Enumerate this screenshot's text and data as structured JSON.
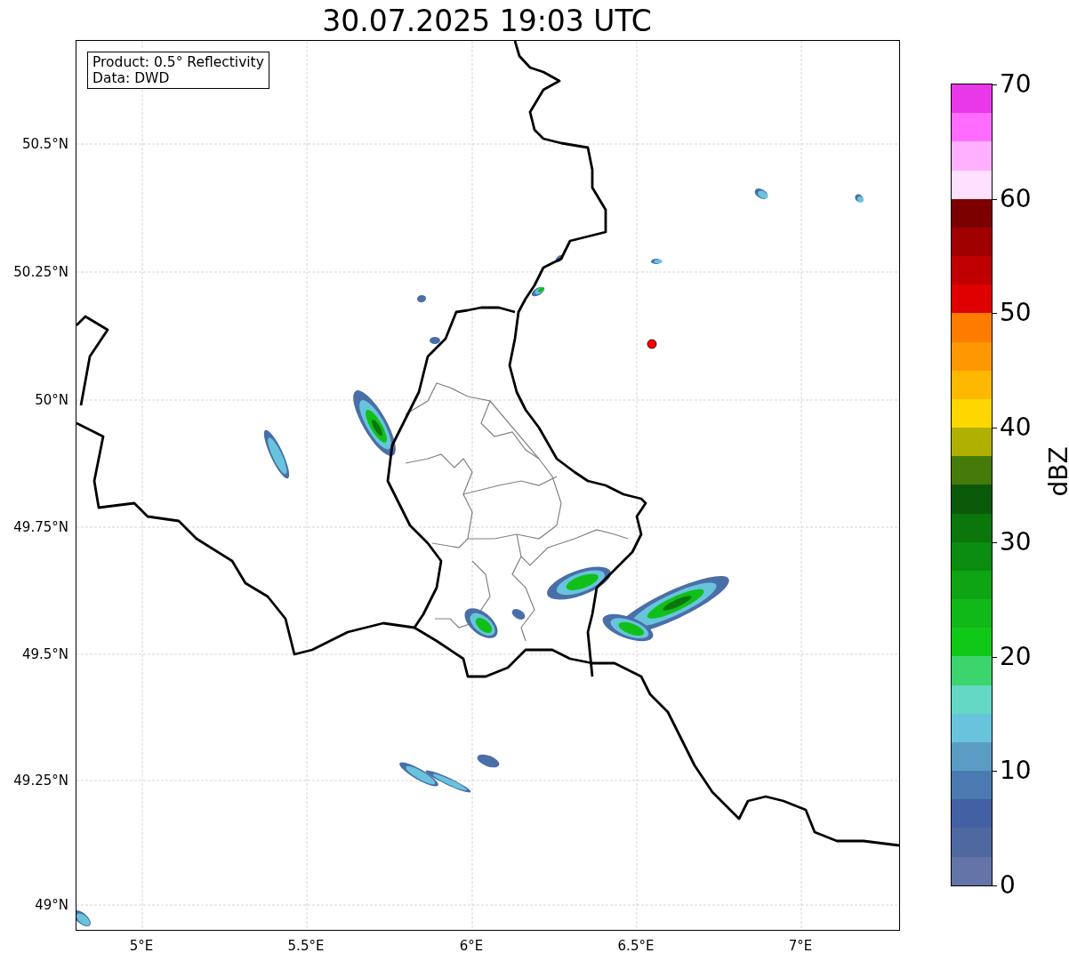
{
  "title": "30.07.2025 19:03 UTC",
  "info_box": {
    "lines": [
      "Product: 0.5° Reflectivity",
      "Data: DWD"
    ]
  },
  "lat_ticks": [
    "50.5°N",
    "50.25°N",
    "50°N",
    "49.75°N",
    "49.5°N",
    "49.25°N",
    "49°N"
  ],
  "lon_ticks": [
    "5°E",
    "5.5°E",
    "6°E",
    "6.5°E",
    "7°E"
  ],
  "colorbar": {
    "label": "dBZ",
    "ticks": [
      "70",
      "60",
      "50",
      "40",
      "30",
      "20",
      "10",
      "0"
    ],
    "bins": [
      {
        "color": "#e838e8"
      },
      {
        "color": "#ff6cff"
      },
      {
        "color": "#ffb0ff"
      },
      {
        "color": "#ffe0ff"
      },
      {
        "color": "#7c0000"
      },
      {
        "color": "#a00000"
      },
      {
        "color": "#c00000"
      },
      {
        "color": "#e00000"
      },
      {
        "color": "#ff7c00"
      },
      {
        "color": "#ff9800"
      },
      {
        "color": "#ffb800"
      },
      {
        "color": "#ffd700"
      },
      {
        "color": "#b0b000"
      },
      {
        "color": "#467a0a"
      },
      {
        "color": "#0a5a0a"
      },
      {
        "color": "#0a760c"
      },
      {
        "color": "#0a8c10"
      },
      {
        "color": "#0ea414"
      },
      {
        "color": "#10b818"
      },
      {
        "color": "#10c818"
      },
      {
        "color": "#3cd46c"
      },
      {
        "color": "#64d8c4"
      },
      {
        "color": "#68c4dc"
      },
      {
        "color": "#5a9cc4"
      },
      {
        "color": "#4a7ab0"
      },
      {
        "color": "#4460a4"
      },
      {
        "color": "#5068a0"
      },
      {
        "color": "#6474a8"
      }
    ]
  }
}
